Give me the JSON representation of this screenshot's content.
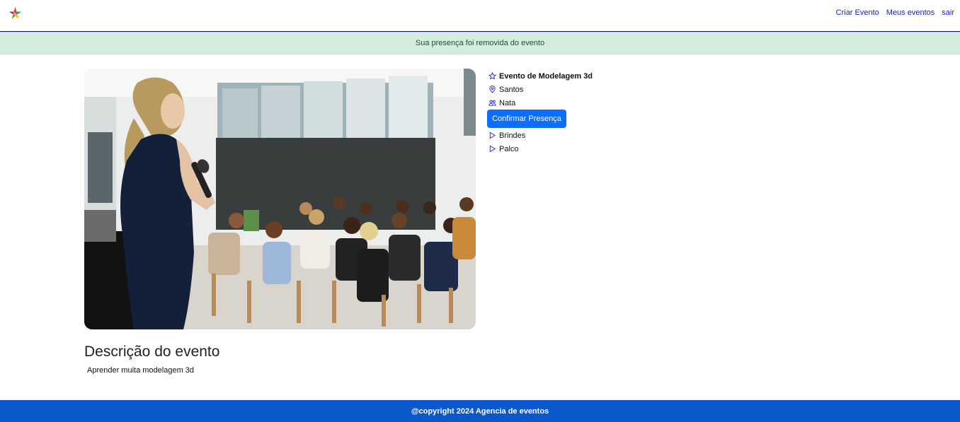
{
  "nav": {
    "logo_icon": "colorful-star-logo",
    "links": [
      "Criar Evento",
      "Meus eventos",
      "sair"
    ]
  },
  "alert": {
    "message": "Sua presença foi removida do evento",
    "color": "#d4ecde"
  },
  "event": {
    "title": "Evento de Modelagem 3d",
    "location": "Santos",
    "organizer": "Nata",
    "confirm_label": "Confirmar Presença",
    "items": [
      "Brindes",
      "Palco"
    ]
  },
  "description": {
    "heading": "Descrição do evento",
    "text": "Aprender muita modelagem 3d"
  },
  "footer": {
    "text": "@copyright 2024 Agencia de eventos",
    "color": "#0a58ca"
  },
  "colors": {
    "accent": "#0d6efd",
    "link": "#1a1ac8"
  }
}
